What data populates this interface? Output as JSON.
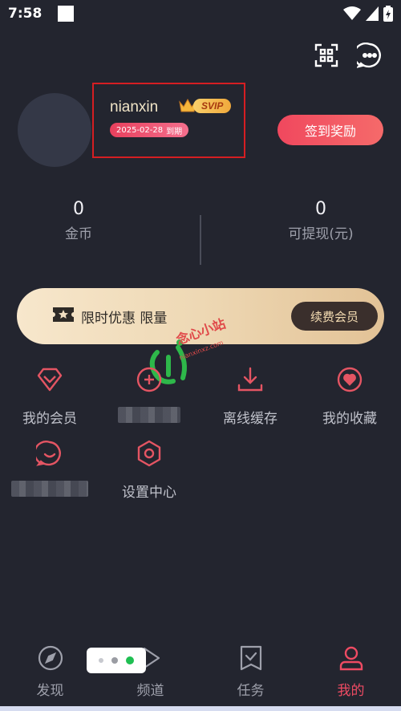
{
  "status_bar": {
    "time": "7:58"
  },
  "profile": {
    "username": "nianxin",
    "vip_badge": "SVIP",
    "expire_date": "2025-02-28",
    "expire_suffix": "到期",
    "checkin_label": "签到奖励"
  },
  "stats": [
    {
      "value": "0",
      "label": "金币"
    },
    {
      "value": "0",
      "label": "可提现(元)"
    }
  ],
  "promo": {
    "text": "限时优惠 限量",
    "button": "续费会员"
  },
  "grid": [
    {
      "label": "我的会员",
      "icon": "diamond-icon"
    },
    {
      "label": "",
      "icon": "headset-icon"
    },
    {
      "label": "离线缓存",
      "icon": "download-icon"
    },
    {
      "label": "我的收藏",
      "icon": "heart-icon"
    },
    {
      "label": "",
      "icon": "chat-icon"
    },
    {
      "label": "设置中心",
      "icon": "settings-hex-icon"
    }
  ],
  "watermark": {
    "text": "念心小站",
    "sub": "nianxinxz.com"
  },
  "tabs": [
    {
      "label": "发现",
      "icon": "compass-icon"
    },
    {
      "label": "频道",
      "icon": "channel-icon"
    },
    {
      "label": "任务",
      "icon": "task-icon"
    },
    {
      "label": "我的",
      "icon": "user-icon",
      "active": true
    }
  ],
  "colors": {
    "accent": "#ee4b63",
    "background": "#23252f",
    "gold": "#f0a93c"
  }
}
